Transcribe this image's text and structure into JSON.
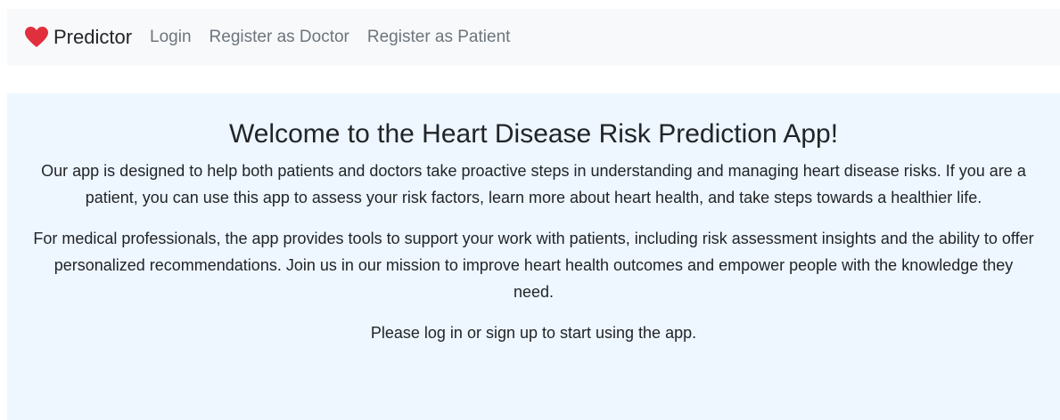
{
  "navbar": {
    "brand": "Predictor",
    "brand_icon": "heart-icon",
    "brand_color": "#e0303d",
    "links": [
      {
        "label": "Login"
      },
      {
        "label": "Register as Doctor"
      },
      {
        "label": "Register as Patient"
      }
    ]
  },
  "hero": {
    "title": "Welcome to the Heart Disease Risk Prediction App!",
    "paragraphs": [
      "Our app is designed to help both patients and doctors take proactive steps in understanding and managing heart disease risks. If you are a patient, you can use this app to assess your risk factors, learn more about heart health, and take steps towards a healthier life.",
      "For medical professionals, the app provides tools to support your work with patients, including risk assessment insights and the ability to offer personalized recommendations. Join us in our mission to improve heart health outcomes and empower people with the knowledge they need.",
      "Please log in or sign up to start using the app."
    ]
  }
}
